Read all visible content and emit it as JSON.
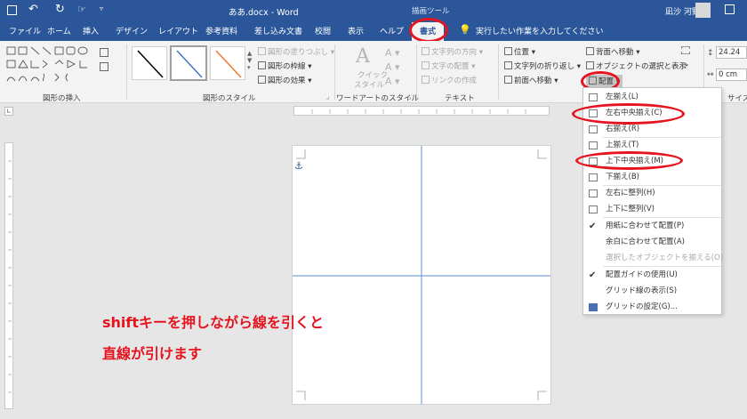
{
  "title_bar": {
    "doc_title": "ああ.docx - Word",
    "tools_label": "描画ツール",
    "user_name": "凪沙 河野"
  },
  "tabs": [
    "ファイル",
    "ホーム",
    "挿入",
    "デザイン",
    "レイアウト",
    "参考資料",
    "差し込み文書",
    "校閲",
    "表示",
    "ヘルプ",
    "書式"
  ],
  "tell_me": "実行したい作業を入力してください",
  "ribbon": {
    "insert_shapes_label": "図形の挿入",
    "shape_styles_label": "図形のスタイル",
    "fill": "図形の塗りつぶし",
    "outline": "図形の枠線",
    "effects": "図形の効果",
    "quick_style_1": "クイック",
    "quick_style_2": "スタイル",
    "wordart_label": "ワードアートのスタイル",
    "text_dir": "文字列の方向",
    "text_align": "文字の配置",
    "link": "リンクの作成",
    "text_label": "テキスト",
    "position": "位置",
    "wrap": "文字列の折り返し",
    "forward": "前面へ移動",
    "backward": "背面へ移動",
    "selection_pane": "オブジェクトの選択と表示",
    "align": "配置",
    "size_h": "24.24",
    "size_w": "0 cm",
    "size_label": "サイズ"
  },
  "menu": {
    "items": [
      {
        "label": "左揃え(L)",
        "enabled": true
      },
      {
        "label": "左右中央揃え(C)",
        "enabled": true
      },
      {
        "label": "右揃え(R)",
        "enabled": true
      },
      {
        "label": "上揃え(T)",
        "enabled": true
      },
      {
        "label": "上下中央揃え(M)",
        "enabled": true
      },
      {
        "label": "下揃え(B)",
        "enabled": true
      },
      {
        "label": "左右に整列(H)",
        "enabled": true
      },
      {
        "label": "上下に整列(V)",
        "enabled": true
      },
      {
        "label": "用紙に合わせて配置(P)",
        "enabled": true,
        "checked": true
      },
      {
        "label": "余白に合わせて配置(A)",
        "enabled": true
      },
      {
        "label": "選択したオブジェクトを揃える(O)",
        "enabled": false
      },
      {
        "label": "配置ガイドの使用(U)",
        "enabled": true,
        "checked": true
      },
      {
        "label": "グリッド線の表示(S)",
        "enabled": true
      },
      {
        "label": "グリッドの設定(G)...",
        "enabled": true
      }
    ]
  },
  "annotation": {
    "line1": "shiftキーを押しながら線を引くと",
    "line2": "直線が引けます"
  },
  "colors": {
    "brand": "#2b579a",
    "annotation": "#e6141f"
  }
}
